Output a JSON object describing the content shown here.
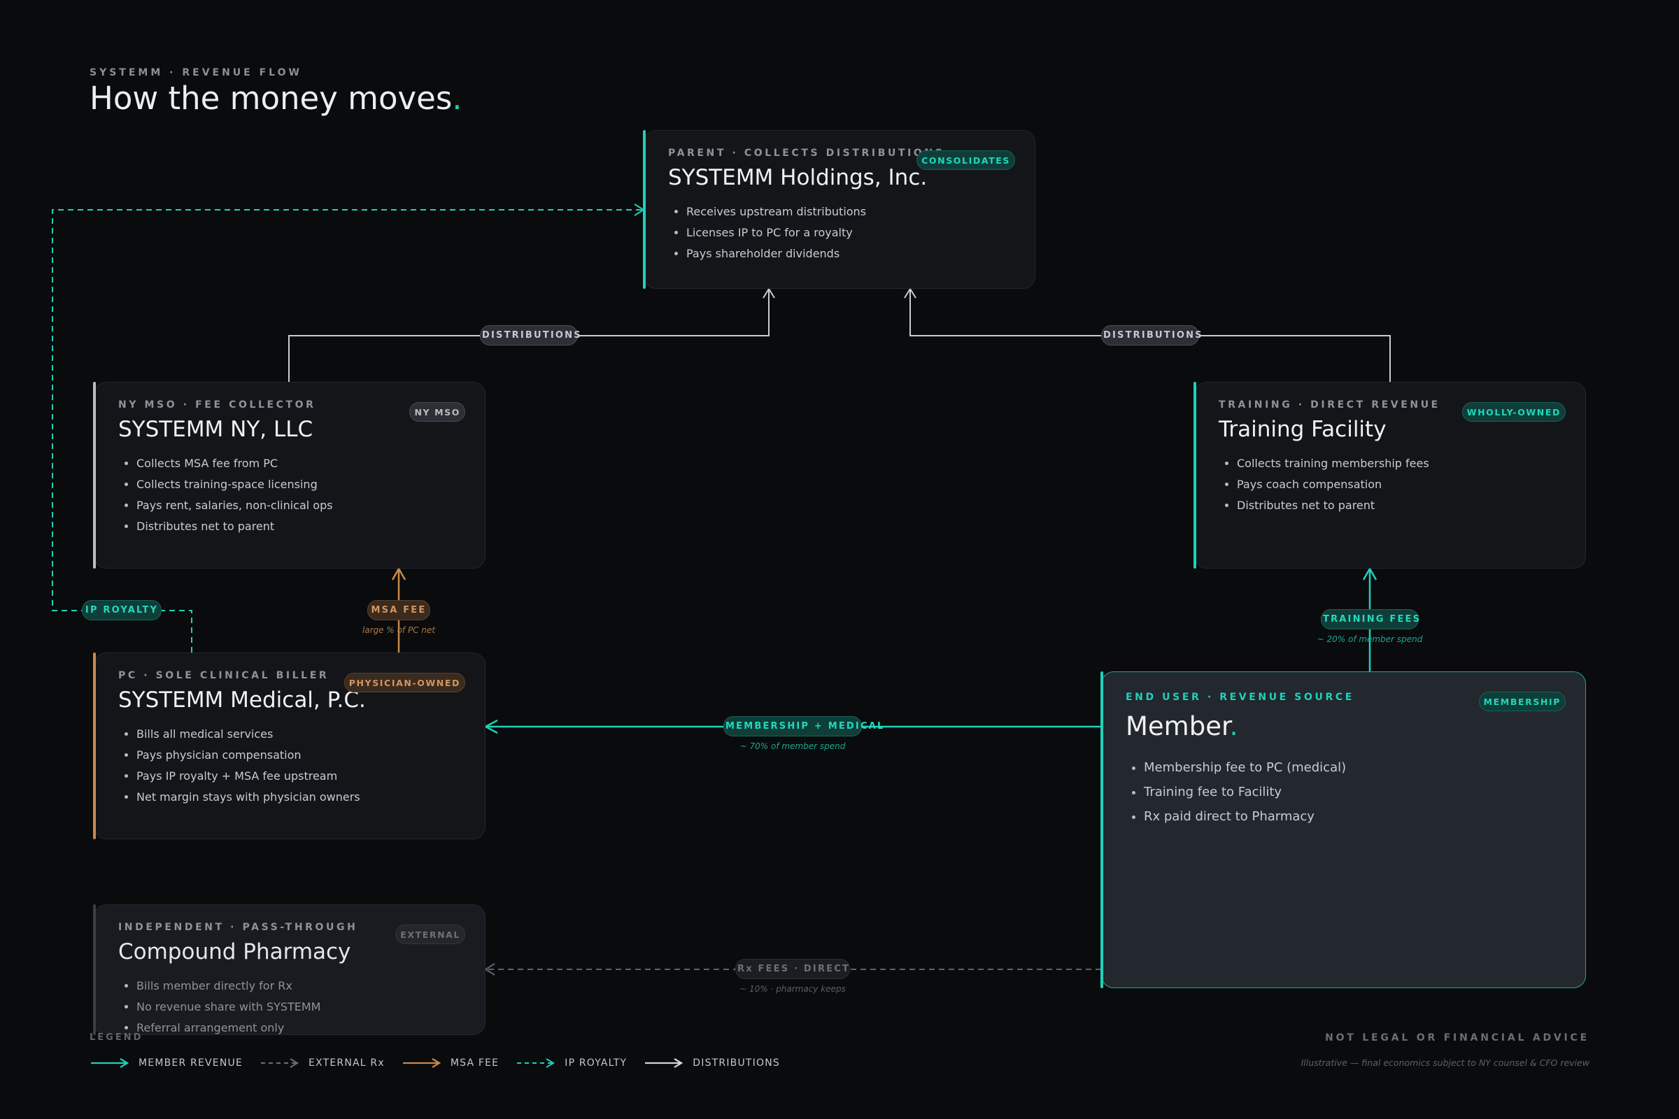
{
  "header": {
    "kicker": "SYSTEMM · REVENUE FLOW",
    "title": "How the money moves",
    "title_dot": "."
  },
  "colors": {
    "teal": "#1fd1b9",
    "amber": "#c8894c",
    "grey": "#b9bdc3",
    "dim": "#6b6f76",
    "background": "#0a0b0d"
  },
  "cards": {
    "holdings": {
      "eyebrow": "PARENT · COLLECTS DISTRIBUTIONS",
      "name": "SYSTEMM Holdings, Inc.",
      "badge": "CONSOLIDATES",
      "items": [
        "Receives upstream distributions",
        "Licenses IP to PC for a royalty",
        "Pays shareholder dividends"
      ]
    },
    "ny": {
      "eyebrow": "NY MSO · FEE COLLECTOR",
      "name": "SYSTEMM NY, LLC",
      "badge": "NY MSO",
      "items": [
        "Collects MSA fee from PC",
        "Collects training-space licensing",
        "Pays rent, salaries, non-clinical ops",
        "Distributes net to parent"
      ]
    },
    "training": {
      "eyebrow": "TRAINING · DIRECT REVENUE",
      "name": "Training Facility",
      "badge": "WHOLLY-OWNED",
      "items": [
        "Collects training membership fees",
        "Pays coach compensation",
        "Distributes net to parent"
      ]
    },
    "medical": {
      "eyebrow": "PC · SOLE CLINICAL BILLER",
      "name": "SYSTEMM Medical, P.C.",
      "badge": "PHYSICIAN-OWNED",
      "items": [
        "Bills all medical services",
        "Pays physician compensation",
        "Pays IP royalty + MSA fee upstream",
        "Net margin stays with physician owners"
      ]
    },
    "member": {
      "eyebrow": "END USER · REVENUE SOURCE",
      "name": "Member",
      "name_dot": ".",
      "badge": "MEMBERSHIP",
      "items": [
        "Membership fee to PC (medical)",
        "Training fee to Facility",
        "Rx paid direct to Pharmacy"
      ]
    },
    "pharmacy": {
      "eyebrow": "INDEPENDENT · PASS-THROUGH",
      "name": "Compound Pharmacy",
      "badge": "EXTERNAL",
      "items": [
        "Bills member directly for Rx",
        "No revenue share with SYSTEMM",
        "Referral arrangement only"
      ]
    }
  },
  "flows": {
    "distributions_left": "DISTRIBUTIONS",
    "distributions_right": "DISTRIBUTIONS",
    "ip_royalty": "IP ROYALTY",
    "msa_fee": "MSA FEE",
    "msa_fee_note": "large % of PC net",
    "training_fees": "TRAINING FEES",
    "training_fees_note": "~ 20% of member spend",
    "membership_medical": "MEMBERSHIP + MEDICAL",
    "membership_medical_note": "~ 70% of member spend",
    "rx_fees": "Rx FEES · DIRECT",
    "rx_fees_note": "~ 10% · pharmacy keeps"
  },
  "legend": {
    "title": "LEGEND",
    "items": [
      {
        "label": "MEMBER REVENUE",
        "style": "solid-teal"
      },
      {
        "label": "EXTERNAL Rx",
        "style": "dashed-grey"
      },
      {
        "label": "MSA FEE",
        "style": "solid-amber"
      },
      {
        "label": "IP ROYALTY",
        "style": "dashed-teal"
      },
      {
        "label": "DISTRIBUTIONS",
        "style": "solid-white"
      }
    ]
  },
  "footer": {
    "disclaimer": "NOT LEGAL OR FINANCIAL ADVICE",
    "disclaimer_note": "Illustrative — final economics subject to NY counsel & CFO review"
  }
}
